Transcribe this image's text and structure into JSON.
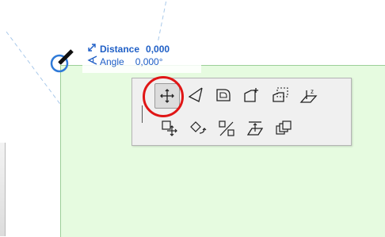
{
  "tracker": {
    "distance_label": "Distance",
    "distance_value": "0,000",
    "angle_label": "Angle",
    "angle_value": "0,000°"
  },
  "pet_palette": {
    "row1": [
      "drag-icon",
      "rotate-icon",
      "fillet-icon",
      "offset-edge-icon",
      "offset-all-edges-icon",
      "elevation-icon"
    ],
    "row2": [
      "drag-copy-icon",
      "rotate-copy-icon",
      "mirror-icon",
      "elevate-icon",
      "multiply-icon"
    ],
    "selected": "drag-icon"
  },
  "colors": {
    "slab_fill": "#e6fbe0",
    "tracker_text": "#1f5fc6",
    "highlight": "#e01616"
  }
}
